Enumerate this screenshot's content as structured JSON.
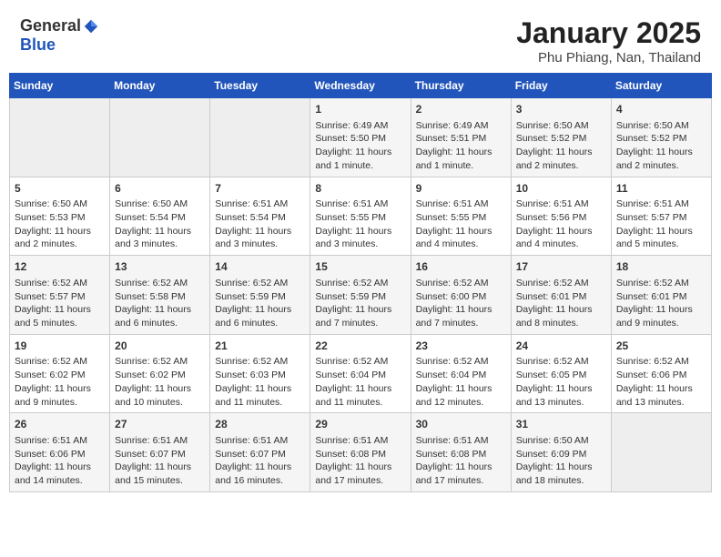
{
  "header": {
    "logo_general": "General",
    "logo_blue": "Blue",
    "main_title": "January 2025",
    "sub_title": "Phu Phiang, Nan, Thailand"
  },
  "weekdays": [
    "Sunday",
    "Monday",
    "Tuesday",
    "Wednesday",
    "Thursday",
    "Friday",
    "Saturday"
  ],
  "weeks": [
    [
      {
        "day": "",
        "info": ""
      },
      {
        "day": "",
        "info": ""
      },
      {
        "day": "",
        "info": ""
      },
      {
        "day": "1",
        "info": "Sunrise: 6:49 AM\nSunset: 5:50 PM\nDaylight: 11 hours\nand 1 minute."
      },
      {
        "day": "2",
        "info": "Sunrise: 6:49 AM\nSunset: 5:51 PM\nDaylight: 11 hours\nand 1 minute."
      },
      {
        "day": "3",
        "info": "Sunrise: 6:50 AM\nSunset: 5:52 PM\nDaylight: 11 hours\nand 2 minutes."
      },
      {
        "day": "4",
        "info": "Sunrise: 6:50 AM\nSunset: 5:52 PM\nDaylight: 11 hours\nand 2 minutes."
      }
    ],
    [
      {
        "day": "5",
        "info": "Sunrise: 6:50 AM\nSunset: 5:53 PM\nDaylight: 11 hours\nand 2 minutes."
      },
      {
        "day": "6",
        "info": "Sunrise: 6:50 AM\nSunset: 5:54 PM\nDaylight: 11 hours\nand 3 minutes."
      },
      {
        "day": "7",
        "info": "Sunrise: 6:51 AM\nSunset: 5:54 PM\nDaylight: 11 hours\nand 3 minutes."
      },
      {
        "day": "8",
        "info": "Sunrise: 6:51 AM\nSunset: 5:55 PM\nDaylight: 11 hours\nand 3 minutes."
      },
      {
        "day": "9",
        "info": "Sunrise: 6:51 AM\nSunset: 5:55 PM\nDaylight: 11 hours\nand 4 minutes."
      },
      {
        "day": "10",
        "info": "Sunrise: 6:51 AM\nSunset: 5:56 PM\nDaylight: 11 hours\nand 4 minutes."
      },
      {
        "day": "11",
        "info": "Sunrise: 6:51 AM\nSunset: 5:57 PM\nDaylight: 11 hours\nand 5 minutes."
      }
    ],
    [
      {
        "day": "12",
        "info": "Sunrise: 6:52 AM\nSunset: 5:57 PM\nDaylight: 11 hours\nand 5 minutes."
      },
      {
        "day": "13",
        "info": "Sunrise: 6:52 AM\nSunset: 5:58 PM\nDaylight: 11 hours\nand 6 minutes."
      },
      {
        "day": "14",
        "info": "Sunrise: 6:52 AM\nSunset: 5:59 PM\nDaylight: 11 hours\nand 6 minutes."
      },
      {
        "day": "15",
        "info": "Sunrise: 6:52 AM\nSunset: 5:59 PM\nDaylight: 11 hours\nand 7 minutes."
      },
      {
        "day": "16",
        "info": "Sunrise: 6:52 AM\nSunset: 6:00 PM\nDaylight: 11 hours\nand 7 minutes."
      },
      {
        "day": "17",
        "info": "Sunrise: 6:52 AM\nSunset: 6:01 PM\nDaylight: 11 hours\nand 8 minutes."
      },
      {
        "day": "18",
        "info": "Sunrise: 6:52 AM\nSunset: 6:01 PM\nDaylight: 11 hours\nand 9 minutes."
      }
    ],
    [
      {
        "day": "19",
        "info": "Sunrise: 6:52 AM\nSunset: 6:02 PM\nDaylight: 11 hours\nand 9 minutes."
      },
      {
        "day": "20",
        "info": "Sunrise: 6:52 AM\nSunset: 6:02 PM\nDaylight: 11 hours\nand 10 minutes."
      },
      {
        "day": "21",
        "info": "Sunrise: 6:52 AM\nSunset: 6:03 PM\nDaylight: 11 hours\nand 11 minutes."
      },
      {
        "day": "22",
        "info": "Sunrise: 6:52 AM\nSunset: 6:04 PM\nDaylight: 11 hours\nand 11 minutes."
      },
      {
        "day": "23",
        "info": "Sunrise: 6:52 AM\nSunset: 6:04 PM\nDaylight: 11 hours\nand 12 minutes."
      },
      {
        "day": "24",
        "info": "Sunrise: 6:52 AM\nSunset: 6:05 PM\nDaylight: 11 hours\nand 13 minutes."
      },
      {
        "day": "25",
        "info": "Sunrise: 6:52 AM\nSunset: 6:06 PM\nDaylight: 11 hours\nand 13 minutes."
      }
    ],
    [
      {
        "day": "26",
        "info": "Sunrise: 6:51 AM\nSunset: 6:06 PM\nDaylight: 11 hours\nand 14 minutes."
      },
      {
        "day": "27",
        "info": "Sunrise: 6:51 AM\nSunset: 6:07 PM\nDaylight: 11 hours\nand 15 minutes."
      },
      {
        "day": "28",
        "info": "Sunrise: 6:51 AM\nSunset: 6:07 PM\nDaylight: 11 hours\nand 16 minutes."
      },
      {
        "day": "29",
        "info": "Sunrise: 6:51 AM\nSunset: 6:08 PM\nDaylight: 11 hours\nand 17 minutes."
      },
      {
        "day": "30",
        "info": "Sunrise: 6:51 AM\nSunset: 6:08 PM\nDaylight: 11 hours\nand 17 minutes."
      },
      {
        "day": "31",
        "info": "Sunrise: 6:50 AM\nSunset: 6:09 PM\nDaylight: 11 hours\nand 18 minutes."
      },
      {
        "day": "",
        "info": ""
      }
    ]
  ]
}
